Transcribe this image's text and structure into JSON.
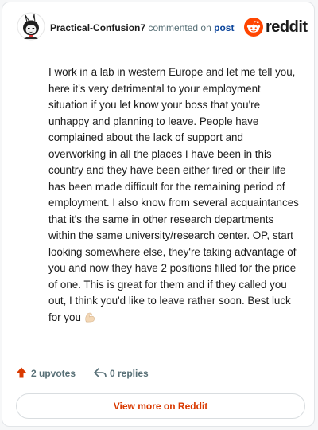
{
  "comment": {
    "username": "Practical-Confusion7",
    "action_text": "commented on",
    "post_link_text": "post",
    "body": "I work in a lab in western Europe and let me tell you, here it's very detrimental to your employment situation if you let know your boss that you're unhappy and planning to leave. People have complained about the lack of support and overworking in all the places I have been in this country and they have been either fired or their life has been made difficult for the remaining period of employment. I also know from several acquaintances that it's the same in other research departments within the same university/research center. OP, start looking somewhere else, they're taking advantage of you and now they have 2 positions filled for the price of one. This is great for them and if they called you out, I think you'd like to leave rather soon. Best luck for you",
    "emoji": "flexed-biceps-light-skin"
  },
  "brand": {
    "wordmark": "reddit",
    "icon": "reddit-snoo-icon",
    "accent_color": "#ff4500"
  },
  "footer": {
    "upvotes_label": "2 upvotes",
    "replies_label": "0 replies",
    "upvote_icon": "upvote-arrow-icon",
    "reply_icon": "reply-arrow-icon",
    "upvote_color": "#d93900"
  },
  "actions": {
    "view_more_label": "View more on Reddit"
  }
}
